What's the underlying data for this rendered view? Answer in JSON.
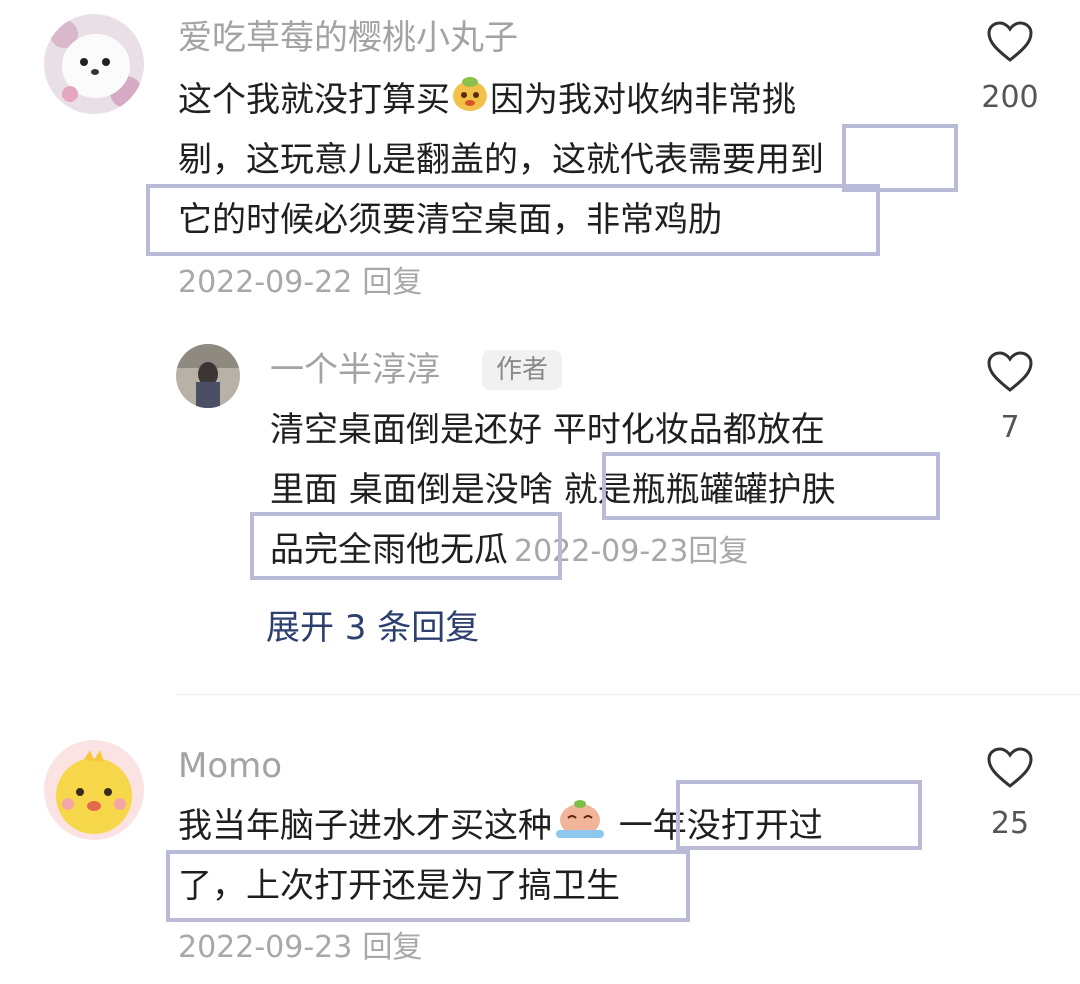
{
  "comments": [
    {
      "username": "爱吃草莓的樱桃小丸子",
      "avatar_icon": "white-fluffy-dog-avatar",
      "text_lines": [
        "这个我就没打算买",
        "因为我对收纳非常挑",
        "剔，这玩意儿是翻盖的，这就代表需要用到",
        "它的时候必须要清空桌面，非常鸡肋"
      ],
      "emoji_icon": "peach-emoji",
      "date": "2022-09-22",
      "reply_label": "回复",
      "like_count": "200"
    },
    {
      "username": "一个半淳淳",
      "author_tag": "作者",
      "avatar_icon": "girl-photo-avatar",
      "text_lines": [
        "清空桌面倒是还好 平时化妆品都放在",
        "里面 桌面倒是没啥 就是瓶瓶罐罐护肤",
        "品完全雨他无瓜"
      ],
      "date": "2022-09-23",
      "reply_label": "回复",
      "like_count": "7"
    },
    {
      "username": "Momo",
      "avatar_icon": "yellow-cartoon-avatar",
      "text_lines": [
        "我当年脑子进水才买这种",
        " 一年没打开过",
        "了，上次打开还是为了搞卫生"
      ],
      "emoji_icon": "crying-emoji",
      "date": "2022-09-23",
      "reply_label": "回复",
      "like_count": "25"
    }
  ],
  "expand_replies_label": "展开 3 条回复",
  "colors": {
    "highlight_border": "#b9bad8",
    "expand_link": "#2c3f6e",
    "muted_text": "#a3a3a3"
  }
}
